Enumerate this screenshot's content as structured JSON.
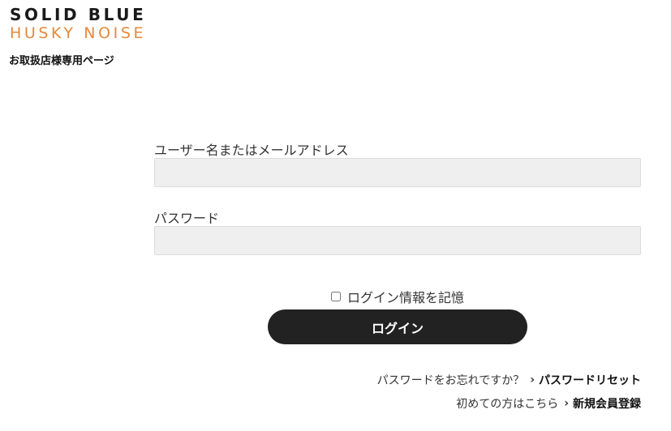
{
  "brand": {
    "line1": "SOLID BLUE",
    "line2": "HUSKY NOISE",
    "line2_color": "#e38a3b"
  },
  "header": {
    "subtitle": "お取扱店様専用ページ"
  },
  "form": {
    "username_label": "ユーザー名またはメールアドレス",
    "username_value": "",
    "password_label": "パスワード",
    "password_value": "",
    "remember_label": "ログイン情報を記憶",
    "remember_checked": false,
    "login_label": "ログイン"
  },
  "links": {
    "forgot_text": "パスワードをお忘れですか？",
    "forgot_link": "パスワードリセット",
    "register_text": "初めての方はこちら",
    "register_link": "新規会員登録",
    "chevron": "›"
  },
  "colors": {
    "button_bg": "#222222",
    "input_bg": "#efefef",
    "accent": "#e38a3b"
  }
}
